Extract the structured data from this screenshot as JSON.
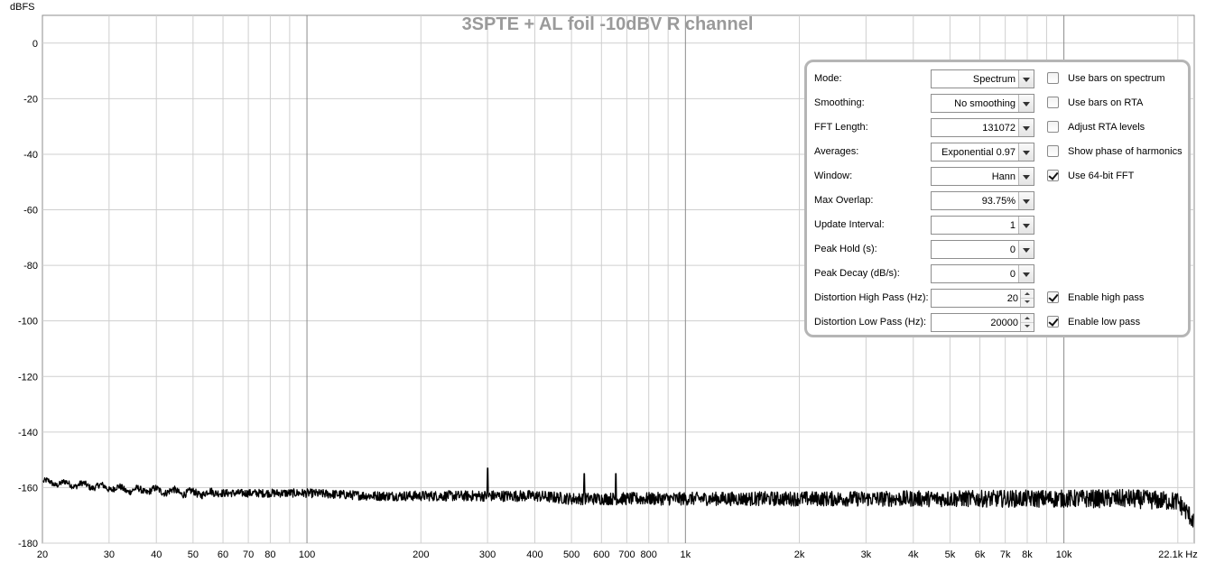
{
  "chart_data": {
    "type": "line",
    "title": "3SPTE + AL foil -10dBV R channel",
    "ylabel": "dBFS",
    "xlabel": "",
    "x_unit": "Hz",
    "x_scale": "log",
    "xlim": [
      20,
      22100
    ],
    "ylim": [
      -180,
      10
    ],
    "y_ticks": [
      0,
      -20,
      -40,
      -60,
      -80,
      -100,
      -120,
      -140,
      -160,
      -180
    ],
    "y_tick_labels": [
      "0",
      "-20",
      "-40",
      "-60",
      "-80",
      "-100",
      "-120",
      "-140",
      "-160",
      "-180"
    ],
    "x_ticks": [
      20,
      30,
      40,
      50,
      60,
      70,
      80,
      100,
      200,
      300,
      400,
      500,
      600,
      700,
      800,
      1000,
      2000,
      3000,
      4000,
      5000,
      6000,
      7000,
      8000,
      10000,
      22100
    ],
    "x_tick_labels": [
      "20",
      "30",
      "40",
      "50",
      "60",
      "70",
      "80",
      "100",
      "200",
      "300",
      "400",
      "500",
      "600",
      "700",
      "800",
      "1k",
      "2k",
      "3k",
      "4k",
      "5k",
      "6k",
      "7k",
      "8k",
      "10k",
      "22.1k Hz"
    ],
    "grid": true,
    "line_color": "#000000",
    "series": [
      {
        "x": [
          20,
          25,
          30,
          35,
          40,
          50,
          60,
          70,
          80,
          100,
          150,
          200,
          250,
          300,
          350,
          400,
          500,
          540,
          600,
          655,
          700,
          800,
          1000,
          1500,
          2000,
          3000,
          4000,
          5000,
          6000,
          7000,
          8000,
          10000,
          15000,
          20000,
          22100
        ],
        "y": [
          -158,
          -159,
          -160,
          -161,
          -161,
          -162,
          -162,
          -162,
          -162,
          -162,
          -163,
          -163,
          -163,
          -163,
          -163,
          -163,
          -164,
          -164,
          -164,
          -164,
          -164,
          -164,
          -164,
          -164,
          -164,
          -164,
          -164,
          -164,
          -164,
          -164,
          -164,
          -164,
          -164,
          -165,
          -172
        ],
        "peaks": [
          {
            "x": 300,
            "y": -153
          },
          {
            "x": 540,
            "y": -155
          },
          {
            "x": 655,
            "y": -155
          }
        ],
        "noise_spread_db": [
          2,
          7
        ]
      }
    ]
  },
  "panel": {
    "rows": [
      {
        "label": "Mode:",
        "control": "combo",
        "value": "Spectrum",
        "check_label": "Use bars on spectrum",
        "checked": false
      },
      {
        "label": "Smoothing:",
        "control": "combo",
        "value": "No  smoothing",
        "check_label": "Use bars on RTA",
        "checked": false
      },
      {
        "label": "FFT Length:",
        "control": "combo",
        "value": "131072",
        "check_label": "Adjust RTA levels",
        "checked": false
      },
      {
        "label": "Averages:",
        "control": "combo",
        "value": "Exponential 0.97",
        "check_label": "Show phase of harmonics",
        "checked": false
      },
      {
        "label": "Window:",
        "control": "combo",
        "value": "Hann",
        "check_label": "Use 64-bit FFT",
        "checked": true
      },
      {
        "label": "Max Overlap:",
        "control": "combo",
        "value": "93.75%",
        "check_label": "",
        "checked": null
      },
      {
        "label": "Update Interval:",
        "control": "combo",
        "value": "1",
        "check_label": "",
        "checked": null
      },
      {
        "label": "Peak Hold (s):",
        "control": "combo",
        "value": "0",
        "check_label": "",
        "checked": null
      },
      {
        "label": "Peak Decay (dB/s):",
        "control": "combo",
        "value": "0",
        "check_label": "",
        "checked": null
      },
      {
        "label": "Distortion High Pass (Hz):",
        "control": "spin",
        "value": "20",
        "check_label": "Enable high pass",
        "checked": true
      },
      {
        "label": "Distortion Low Pass (Hz):",
        "control": "spin",
        "value": "20000",
        "check_label": "Enable low pass",
        "checked": true
      }
    ]
  }
}
